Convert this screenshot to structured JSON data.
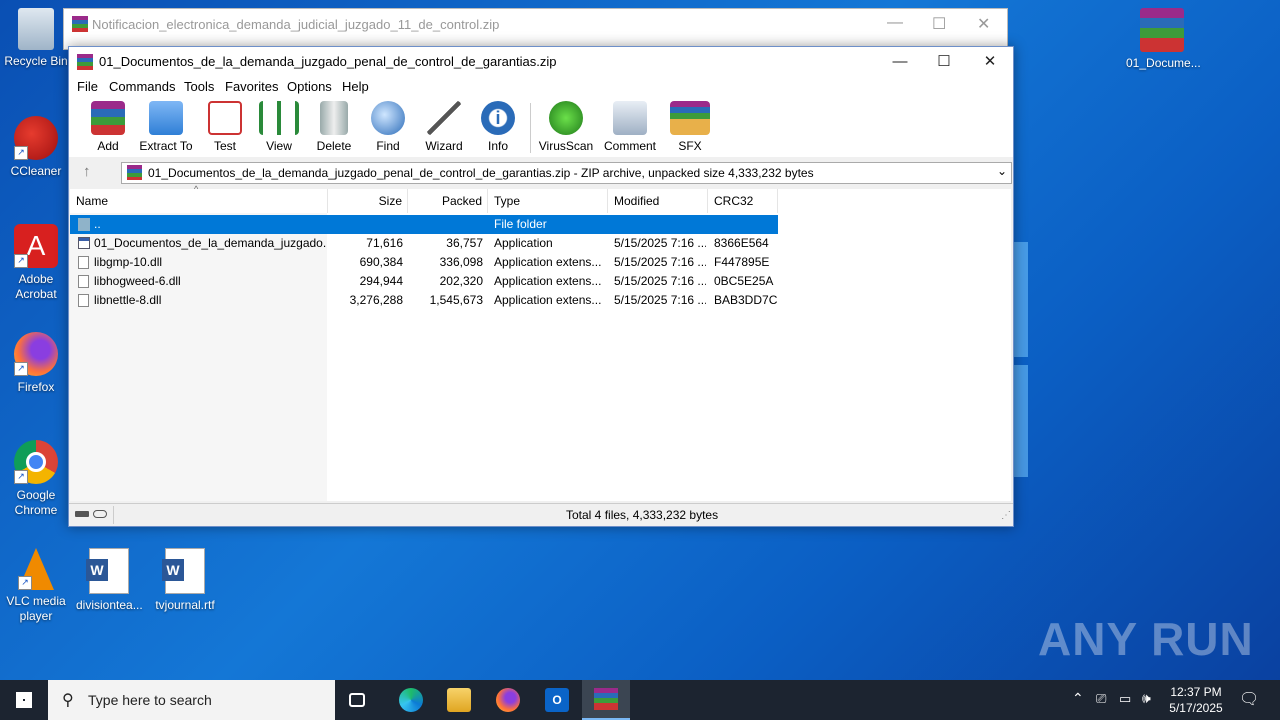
{
  "desktop": {
    "icons": [
      {
        "label": "Recycle Bin"
      },
      {
        "label": "CCleaner"
      },
      {
        "label": "Adobe Acrobat"
      },
      {
        "label": "Firefox"
      },
      {
        "label": "Google Chrome"
      },
      {
        "label": "VLC media player"
      },
      {
        "label": "divisiontea..."
      },
      {
        "label": "tvjournal.rtf"
      },
      {
        "label": "01_Docume..."
      }
    ],
    "watermark": "ANY RUN"
  },
  "back_window": {
    "title": "Notificacion_electronica_demanda_judicial_juzgado_11_de_control.zip"
  },
  "window": {
    "title": "01_Documentos_de_la_demanda_juzgado_penal_de_control_de_garantias.zip",
    "menu": [
      "File",
      "Commands",
      "Tools",
      "Favorites",
      "Options",
      "Help"
    ],
    "toolbar": [
      "Add",
      "Extract To",
      "Test",
      "View",
      "Delete",
      "Find",
      "Wizard",
      "Info",
      "VirusScan",
      "Comment",
      "SFX"
    ],
    "address": "01_Documentos_de_la_demanda_juzgado_penal_de_control_de_garantias.zip - ZIP archive, unpacked size 4,333,232 bytes",
    "columns": [
      "Name",
      "Size",
      "Packed",
      "Type",
      "Modified",
      "CRC32"
    ],
    "rows": [
      {
        "name": "..",
        "size": "",
        "packed": "",
        "type": "File folder",
        "modified": "",
        "crc": ""
      },
      {
        "name": "01_Documentos_de_la_demanda_juzgado...",
        "size": "71,616",
        "packed": "36,757",
        "type": "Application",
        "modified": "5/15/2025 7:16 ...",
        "crc": "8366E564"
      },
      {
        "name": "libgmp-10.dll",
        "size": "690,384",
        "packed": "336,098",
        "type": "Application extens...",
        "modified": "5/15/2025 7:16 ...",
        "crc": "F447895E"
      },
      {
        "name": "libhogweed-6.dll",
        "size": "294,944",
        "packed": "202,320",
        "type": "Application extens...",
        "modified": "5/15/2025 7:16 ...",
        "crc": "0BC5E25A"
      },
      {
        "name": "libnettle-8.dll",
        "size": "3,276,288",
        "packed": "1,545,673",
        "type": "Application extens...",
        "modified": "5/15/2025 7:16 ...",
        "crc": "BAB3DD7C"
      }
    ],
    "status": "Total 4 files, 4,333,232 bytes"
  },
  "taskbar": {
    "search_placeholder": "Type here to search",
    "time": "12:37 PM",
    "date": "5/17/2025"
  }
}
